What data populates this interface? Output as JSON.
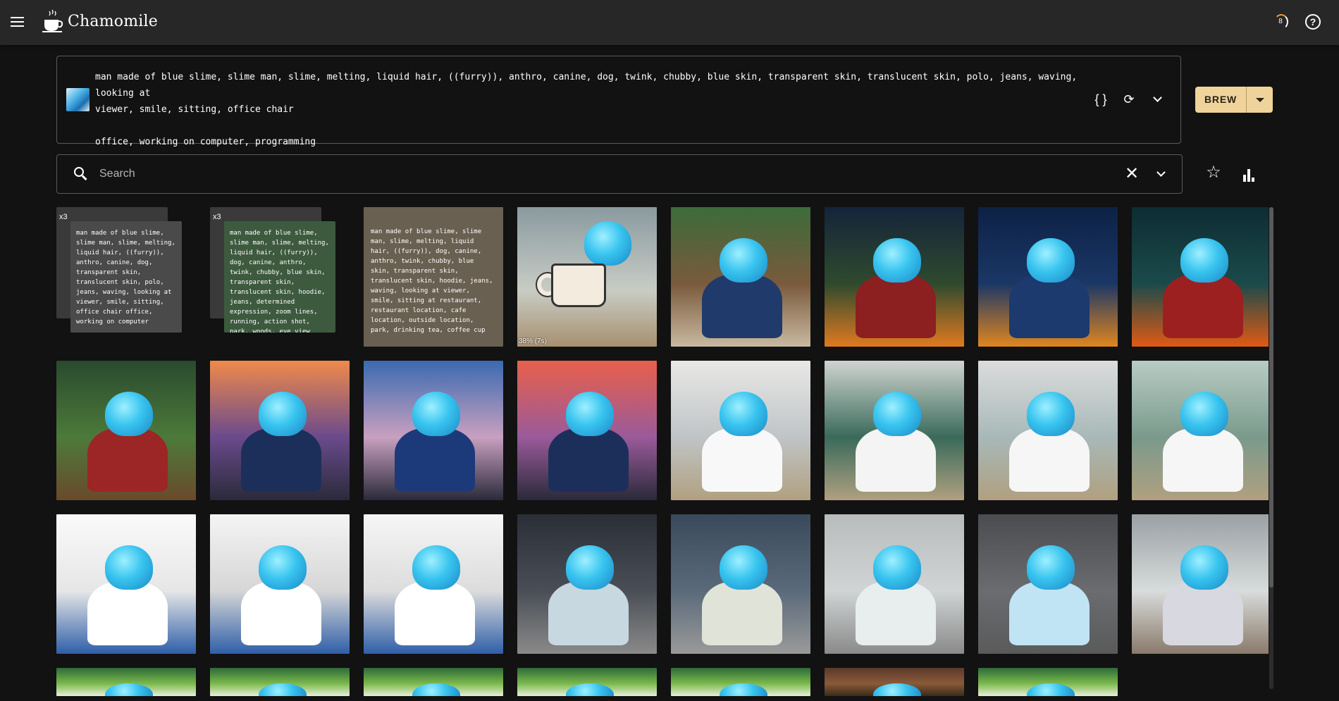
{
  "app": {
    "title": "Chamomile",
    "status_text": "8",
    "menu_icon": "hamburger-menu-icon",
    "help_icon": "help-circle-icon"
  },
  "prompt": {
    "text": "man made of blue slime, slime man, slime, melting, liquid hair, ((furry)), anthro, canine, dog, twink, chubby, blue skin, transparent skin, translucent skin, polo, jeans, waving, looking at\nviewer, smile, sitting, office chair\n\noffice, working on computer, programming",
    "brew_label": "BREW",
    "icons": [
      "braces-icon",
      "cycle-icon",
      "chevron-down-icon"
    ]
  },
  "search": {
    "placeholder": "Search",
    "value": ""
  },
  "colors": {
    "accent": "#f0d39b",
    "background": "#121212",
    "topbar": "#272727"
  },
  "tiles": [
    {
      "kind": "text-stack",
      "count": "x3",
      "text": "man made of blue slime, slime man, slime, melting, liquid hair, ((furry)), anthro, canine, dog, transparent skin, translucent skin, polo, jeans, waving, looking at viewer, smile, sitting, office chair office, working on computer",
      "tint": "#4a4a4a"
    },
    {
      "kind": "text-stack",
      "count": "x3",
      "text": "man made of blue slime, slime man, slime, melting, liquid hair, ((furry)), dog, canine, anthro, twink, chubby, blue skin, transparent skin, translucent skin, hoodie, jeans, determined expression, zoom lines, running, action shot, park, woods, eye view",
      "tint": "#3d5a3f"
    },
    {
      "kind": "text",
      "text": "man made of blue slime, slime man, slime, melting, liquid hair, ((furry)), dog, canine, anthro, twink, chubby, blue skin, transparent skin, translucent skin, hoodie, jeans, waving, looking at viewer, smile, sitting at restaurant, restaurant location, cafe location, outside location, park, drinking tea, coffee cup",
      "tint": "#6a6052"
    },
    {
      "kind": "progress",
      "label": "38% (7s)"
    },
    {
      "kind": "image",
      "scene": "cafe"
    },
    {
      "kind": "image",
      "scene": "campfire-night"
    },
    {
      "kind": "image",
      "scene": "campfire-blue"
    },
    {
      "kind": "image",
      "scene": "forest-dark"
    },
    {
      "kind": "image",
      "scene": "forest-log"
    },
    {
      "kind": "image",
      "scene": "sunset-railing"
    },
    {
      "kind": "image",
      "scene": "lake-blue"
    },
    {
      "kind": "image",
      "scene": "sunset-lake"
    },
    {
      "kind": "image",
      "scene": "office-light"
    },
    {
      "kind": "image",
      "scene": "office-board"
    },
    {
      "kind": "image",
      "scene": "office-hall"
    },
    {
      "kind": "image",
      "scene": "office-green"
    },
    {
      "kind": "image",
      "scene": "office-white"
    },
    {
      "kind": "image",
      "scene": "desk-monitor"
    },
    {
      "kind": "image",
      "scene": "desk-chair"
    },
    {
      "kind": "image",
      "scene": "computer-dark"
    },
    {
      "kind": "image",
      "scene": "computer-desk"
    },
    {
      "kind": "image",
      "scene": "computer-gray"
    },
    {
      "kind": "image",
      "scene": "drinking-gray"
    },
    {
      "kind": "image",
      "scene": "doorway"
    },
    {
      "kind": "image",
      "scene": "forest-partial"
    },
    {
      "kind": "image",
      "scene": "forest-partial"
    },
    {
      "kind": "image",
      "scene": "forest-partial"
    },
    {
      "kind": "image",
      "scene": "forest-partial"
    },
    {
      "kind": "image",
      "scene": "forest-partial"
    },
    {
      "kind": "image",
      "scene": "cabin-partial"
    },
    {
      "kind": "image",
      "scene": "forest-partial"
    }
  ]
}
